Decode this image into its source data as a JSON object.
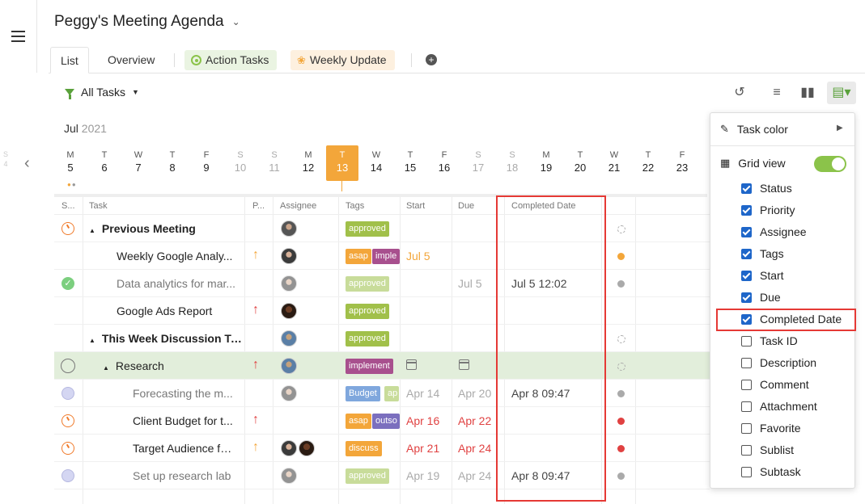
{
  "header": {
    "title": "Peggy's Meeting Agenda"
  },
  "tabs": {
    "list": "List",
    "overview": "Overview",
    "action_tasks": "Action Tasks",
    "weekly_update": "Weekly Update"
  },
  "toolbar": {
    "filter_label": "All Tasks"
  },
  "calendar": {
    "month": "Jul",
    "year": "2021",
    "prev_sub_letter": "S",
    "prev_sub_num": "4",
    "days": [
      {
        "d": "M",
        "n": "5"
      },
      {
        "d": "T",
        "n": "6"
      },
      {
        "d": "W",
        "n": "7"
      },
      {
        "d": "T",
        "n": "8"
      },
      {
        "d": "F",
        "n": "9"
      },
      {
        "d": "S",
        "n": "10"
      },
      {
        "d": "S",
        "n": "11"
      },
      {
        "d": "M",
        "n": "12"
      },
      {
        "d": "T",
        "n": "13"
      },
      {
        "d": "W",
        "n": "14"
      },
      {
        "d": "T",
        "n": "15"
      },
      {
        "d": "F",
        "n": "16"
      },
      {
        "d": "S",
        "n": "17"
      },
      {
        "d": "S",
        "n": "18"
      },
      {
        "d": "M",
        "n": "19"
      },
      {
        "d": "T",
        "n": "20"
      },
      {
        "d": "W",
        "n": "21"
      },
      {
        "d": "T",
        "n": "22"
      },
      {
        "d": "F",
        "n": "23"
      }
    ]
  },
  "grid": {
    "columns": {
      "status": "S...",
      "task": "Task",
      "priority": "P...",
      "assignee": "Assignee",
      "tags": "Tags",
      "start": "Start",
      "due": "Due",
      "completed": "Completed Date"
    },
    "rows": [
      {
        "task": "Previous Meeting"
      },
      {
        "task": "Weekly Google Analy...",
        "tag1": "asap",
        "tag2": "imple",
        "start": "Jul 5"
      },
      {
        "task": "Data analytics for mar...",
        "tag1": "approved",
        "due": "Jul 5",
        "completed": "Jul 5 12:02"
      },
      {
        "task": "Google Ads Report",
        "tag1": "approved"
      },
      {
        "task": "This Week Discussion To...",
        "tag1": "approved"
      },
      {
        "task": "Research",
        "tag1": "implement"
      },
      {
        "task": "Forecasting the m...",
        "tag1": "Budget",
        "tag2": "ap",
        "start": "Apr 14",
        "due": "Apr 20",
        "completed": "Apr 8 09:47"
      },
      {
        "task": "Client Budget for t...",
        "tag1": "asap",
        "tag2": "outso",
        "start": "Apr 16",
        "due": "Apr 22"
      },
      {
        "task": "Target Audience fo...",
        "tag1": "discuss",
        "start": "Apr 21",
        "due": "Apr 24"
      },
      {
        "task": "Set up research lab",
        "tag1": "approved",
        "start": "Apr 19",
        "due": "Apr 24",
        "completed": "Apr 8 09:47"
      }
    ],
    "row0_tag": "approved"
  },
  "menu": {
    "task_color": "Task color",
    "grid_view": "Grid view",
    "grid_view_on": true,
    "options": [
      {
        "label": "Status",
        "checked": true
      },
      {
        "label": "Priority",
        "checked": true
      },
      {
        "label": "Assignee",
        "checked": true
      },
      {
        "label": "Tags",
        "checked": true
      },
      {
        "label": "Start",
        "checked": true
      },
      {
        "label": "Due",
        "checked": true
      },
      {
        "label": "Completed Date",
        "checked": true
      },
      {
        "label": "Task ID",
        "checked": false
      },
      {
        "label": "Description",
        "checked": false
      },
      {
        "label": "Comment",
        "checked": false
      },
      {
        "label": "Attachment",
        "checked": false
      },
      {
        "label": "Favorite",
        "checked": false
      },
      {
        "label": "Sublist",
        "checked": false
      },
      {
        "label": "Subtask",
        "checked": false
      }
    ]
  },
  "colors": {
    "accent_green": "#5aa13b",
    "today_orange": "#f3a63a",
    "checkbox_blue": "#1e66c9",
    "highlight_red": "#e53935"
  }
}
